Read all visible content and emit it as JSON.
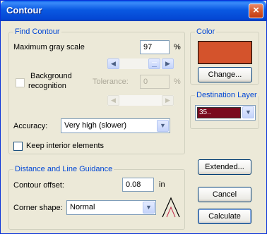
{
  "window": {
    "title": "Contour",
    "close_glyph": "×"
  },
  "find_contour": {
    "title": "Find Contour",
    "max_gray_label": "Maximum gray scale",
    "max_gray_value": "97",
    "max_gray_unit": "%",
    "background_label_1": "Background",
    "background_label_2": "recognition",
    "tolerance_label": "Tolerance:",
    "tolerance_value": "0",
    "tolerance_unit": "%",
    "accuracy_label": "Accuracy:",
    "accuracy_value": "Very high (slower)",
    "keep_interior_label": "Keep interior elements"
  },
  "color": {
    "title": "Color",
    "swatch": "#d4532c",
    "change_button": "Change..."
  },
  "destination_layer": {
    "title": "Destination Layer",
    "layer_value": "35..",
    "layer_color": "#7a0a1e"
  },
  "distance": {
    "title": "Distance and Line Guidance",
    "offset_label": "Contour offset:",
    "offset_value": "0.08",
    "offset_unit": "in",
    "corner_label": "Corner shape:",
    "corner_value": "Normal"
  },
  "buttons": {
    "extended": "Extended...",
    "cancel": "Cancel",
    "calculate": "Calculate"
  },
  "icons": {
    "left_arrow": "◀",
    "right_arrow": "▶",
    "down_arrow": "▼"
  }
}
